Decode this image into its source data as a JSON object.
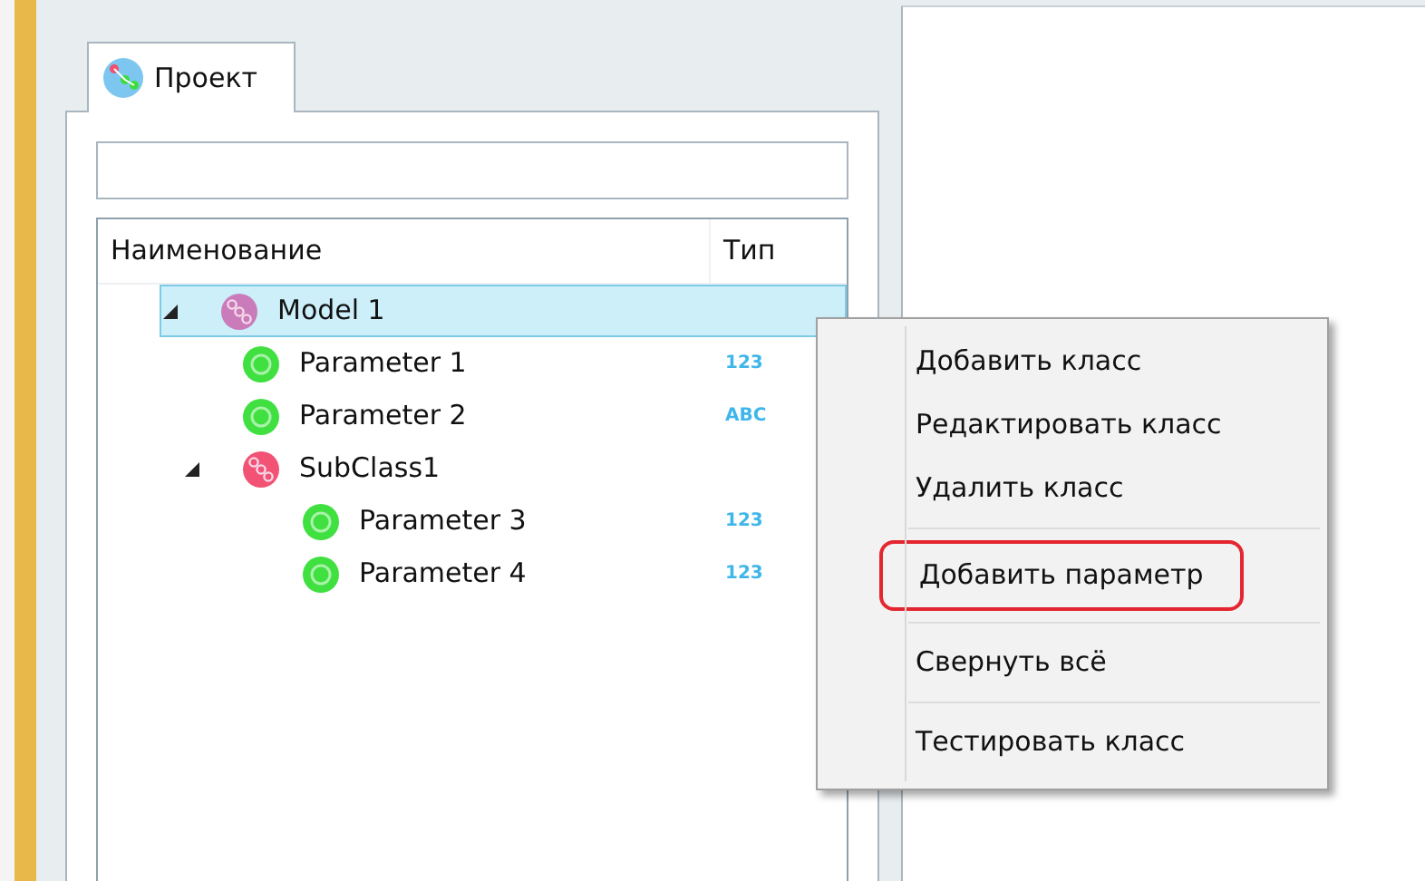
{
  "tab": {
    "label": "Проект",
    "selected": true
  },
  "tree": {
    "columns": [
      "Наименование",
      "Тип"
    ],
    "rows": [
      {
        "kind": "class",
        "name": "Model 1",
        "selected": true,
        "expanded": true,
        "color": "#c97cb9",
        "children": [
          {
            "kind": "parameter",
            "name": "Parameter 1",
            "type": "123",
            "selected": false
          },
          {
            "kind": "parameter",
            "name": "Parameter 2",
            "type": "ABC",
            "selected": false
          },
          {
            "kind": "class",
            "name": "SubClass1",
            "selected": false,
            "expanded": true,
            "color": "#f25273",
            "children": [
              {
                "kind": "parameter",
                "name": "Parameter 3",
                "type": "123",
                "selected": false
              },
              {
                "kind": "parameter",
                "name": "Parameter 4",
                "type": "123",
                "selected": false
              }
            ]
          }
        ]
      }
    ]
  },
  "context_menu": {
    "groups": [
      [
        {
          "label": "Добавить класс",
          "highlighted": false
        },
        {
          "label": "Редактировать класс",
          "highlighted": false
        },
        {
          "label": "Удалить класс",
          "highlighted": false
        }
      ],
      [
        {
          "label": "Добавить параметр",
          "highlighted": true
        }
      ],
      [
        {
          "label": "Свернуть всё",
          "highlighted": false
        }
      ],
      [
        {
          "label": "Тестировать класс",
          "highlighted": false
        }
      ]
    ]
  }
}
